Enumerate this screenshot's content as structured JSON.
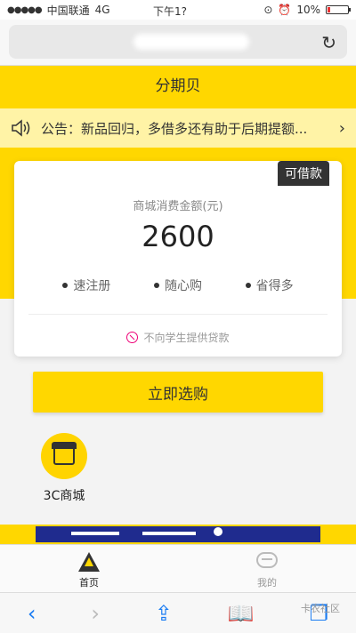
{
  "statusbar": {
    "carrier": "中国联通",
    "network": "4G",
    "time": "下午1?",
    "battery": "10%"
  },
  "header": {
    "title": "分期贝"
  },
  "notice": {
    "text": "公告：新品回归，多借多还有助于后期提额..."
  },
  "card": {
    "badge": "可借款",
    "label": "商城消费金额(元)",
    "amount": "2600",
    "features": [
      "速注册",
      "随心购",
      "省得多"
    ],
    "note": "不向学生提供贷款"
  },
  "buy_button": {
    "label": "立即选购"
  },
  "shortcut": {
    "label": "3C商城"
  },
  "tabbar": {
    "home_label": "首页",
    "me_label": "我的"
  },
  "watermark": "卡农社区"
}
